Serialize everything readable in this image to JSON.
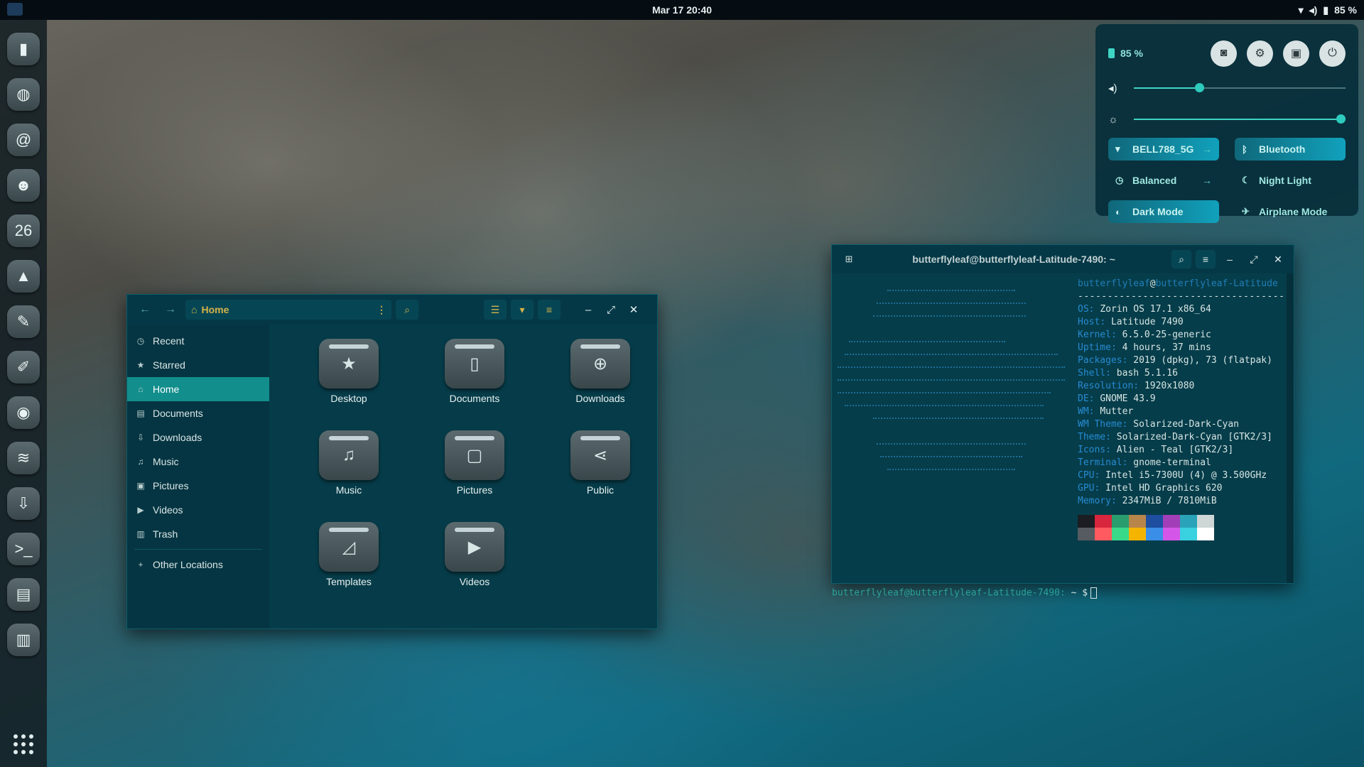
{
  "topbar": {
    "clock": "Mar 17  20:40",
    "battery": "85 %"
  },
  "dock": {
    "items": [
      {
        "name": "files",
        "icon": "▮"
      },
      {
        "name": "browser",
        "icon": "◍"
      },
      {
        "name": "mail",
        "icon": "@"
      },
      {
        "name": "contacts",
        "icon": "☻"
      },
      {
        "name": "calendar",
        "icon": "26"
      },
      {
        "name": "photos",
        "icon": "▲"
      },
      {
        "name": "text-editor",
        "icon": "✎"
      },
      {
        "name": "drawing",
        "icon": "✐"
      },
      {
        "name": "discord",
        "icon": "◉"
      },
      {
        "name": "layers",
        "icon": "≋"
      },
      {
        "name": "software",
        "icon": "⇩"
      },
      {
        "name": "terminal",
        "icon": ">_"
      },
      {
        "name": "archive",
        "icon": "▤"
      },
      {
        "name": "trash",
        "icon": "▥"
      }
    ]
  },
  "quick_settings": {
    "battery_label": "85 %",
    "volume_level": 0.3,
    "brightness_level": 1.0,
    "tiles": [
      {
        "label": "BELL788_5G",
        "icon": "▾",
        "on": true,
        "arrow": "→"
      },
      {
        "label": "Bluetooth",
        "icon": "ᛒ",
        "on": true,
        "arrow": ""
      },
      {
        "label": "Balanced",
        "icon": "◷",
        "on": false,
        "arrow": "→"
      },
      {
        "label": "Night Light",
        "icon": "☾",
        "on": false,
        "arrow": ""
      },
      {
        "label": "Dark Mode",
        "icon": "◐",
        "on": true,
        "arrow": ""
      },
      {
        "label": "Airplane Mode",
        "icon": "✈",
        "on": false,
        "arrow": ""
      }
    ]
  },
  "file_manager": {
    "path": "Home",
    "sidebar": [
      {
        "label": "Recent",
        "icon": "◷"
      },
      {
        "label": "Starred",
        "icon": "★"
      },
      {
        "label": "Home",
        "icon": "⌂",
        "active": true
      },
      {
        "label": "Documents",
        "icon": "▤"
      },
      {
        "label": "Downloads",
        "icon": "⇩"
      },
      {
        "label": "Music",
        "icon": "♫"
      },
      {
        "label": "Pictures",
        "icon": "▣"
      },
      {
        "label": "Videos",
        "icon": "▶"
      },
      {
        "label": "Trash",
        "icon": "▥"
      },
      {
        "label": "Other Locations",
        "icon": "+"
      }
    ],
    "folders": [
      {
        "label": "Desktop",
        "icon": "★"
      },
      {
        "label": "Documents",
        "icon": "▯"
      },
      {
        "label": "Downloads",
        "icon": "⊕"
      },
      {
        "label": "Music",
        "icon": "♫"
      },
      {
        "label": "Pictures",
        "icon": "▢"
      },
      {
        "label": "Public",
        "icon": "⋖"
      },
      {
        "label": "Templates",
        "icon": "◿"
      },
      {
        "label": "Videos",
        "icon": "▶"
      }
    ]
  },
  "terminal": {
    "title": "butterflyleaf@butterflyleaf-Latitude-7490: ~",
    "user": "butterflyleaf",
    "host": "butterflyleaf-Latitude",
    "separator": "-----------------------------------",
    "info": [
      {
        "key": "OS",
        "value": "Zorin OS 17.1 x86_64"
      },
      {
        "key": "Host",
        "value": "Latitude 7490"
      },
      {
        "key": "Kernel",
        "value": "6.5.0-25-generic"
      },
      {
        "key": "Uptime",
        "value": "4 hours, 37 mins"
      },
      {
        "key": "Packages",
        "value": "2019 (dpkg), 73 (flatpak)"
      },
      {
        "key": "Shell",
        "value": "bash 5.1.16"
      },
      {
        "key": "Resolution",
        "value": "1920x1080"
      },
      {
        "key": "DE",
        "value": "GNOME 43.9"
      },
      {
        "key": "WM",
        "value": "Mutter"
      },
      {
        "key": "WM Theme",
        "value": "Solarized-Dark-Cyan"
      },
      {
        "key": "Theme",
        "value": "Solarized-Dark-Cyan [GTK2/3]"
      },
      {
        "key": "Icons",
        "value": "Alien - Teal [GTK2/3]"
      },
      {
        "key": "Terminal",
        "value": "gnome-terminal"
      },
      {
        "key": "CPU",
        "value": "Intel i5-7300U (4) @ 3.500GHz"
      },
      {
        "key": "GPU",
        "value": "Intel HD Graphics 620"
      },
      {
        "key": "Memory",
        "value": "2347MiB / 7810MiB"
      }
    ],
    "palette": [
      "#1b1d22",
      "#d7263d",
      "#2a9d6f",
      "#b8864b",
      "#1d4ea0",
      "#a23fb8",
      "#2aa3b8",
      "#cfd6d6",
      "#555b61",
      "#ff5a5f",
      "#39d98a",
      "#f4b400",
      "#3a8ee6",
      "#d456e8",
      "#39d0e0",
      "#ffffff"
    ],
    "prompt": "butterflyleaf@butterflyleaf-Latitude-7490:",
    "prompt_symbol": "~ $"
  }
}
